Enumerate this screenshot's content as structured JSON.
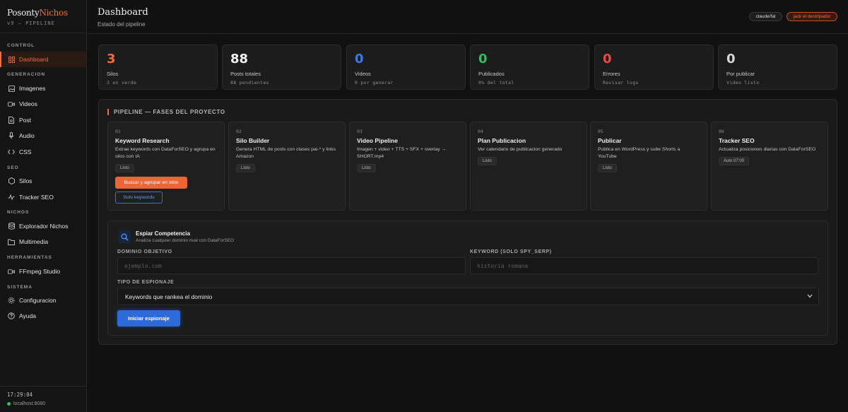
{
  "brand": {
    "title_a": "Posonty",
    "title_b": "Nichos",
    "subtitle": "v9 — PIPELINE"
  },
  "sidebar": {
    "sections": [
      {
        "label": "CONTROL",
        "items": [
          {
            "label": "Dashboard",
            "icon": "dashboard-icon",
            "active": true
          }
        ]
      },
      {
        "label": "GENERACION",
        "items": [
          {
            "label": "Imagenes",
            "icon": "image-icon"
          },
          {
            "label": "Videos",
            "icon": "video-icon"
          },
          {
            "label": "Post",
            "icon": "post-icon"
          },
          {
            "label": "Audio",
            "icon": "microphone-icon"
          },
          {
            "label": "CSS",
            "icon": "code-icon"
          }
        ]
      },
      {
        "label": "SEO",
        "items": [
          {
            "label": "Silos",
            "icon": "hexagon-icon"
          },
          {
            "label": "Tracker SEO",
            "icon": "trend-icon"
          }
        ]
      },
      {
        "label": "NICHOS",
        "items": [
          {
            "label": "Explorador Nichos",
            "icon": "database-icon"
          },
          {
            "label": "Multimedia",
            "icon": "folder-icon"
          }
        ]
      },
      {
        "label": "HERRAMIENTAS",
        "items": [
          {
            "label": "FFmpeg Studio",
            "icon": "video-icon"
          }
        ]
      },
      {
        "label": "SISTEMA",
        "items": [
          {
            "label": "Configuracion",
            "icon": "gear-icon"
          },
          {
            "label": "Ayuda",
            "icon": "help-icon"
          }
        ]
      }
    ],
    "clock": "17:29:04",
    "host": "localhost:8080"
  },
  "header": {
    "title": "Dashboard",
    "subtitle": "Estado del pipeline",
    "model_badge": "claude/fal",
    "user_badge": "jack el destripador"
  },
  "stats": [
    {
      "value": "3",
      "label": "Silos",
      "sub": "3 en verde",
      "color": "#f26b3a"
    },
    {
      "value": "88",
      "label": "Posts totales",
      "sub": "88 pendientes",
      "color": "#f2f2f2"
    },
    {
      "value": "0",
      "label": "Videos",
      "sub": "0 por generar",
      "color": "#3b7be6"
    },
    {
      "value": "0",
      "label": "Publicados",
      "sub": "0% del total",
      "color": "#2fbf5b"
    },
    {
      "value": "0",
      "label": "Errores",
      "sub": "Revisar logs",
      "color": "#ef4a3e"
    },
    {
      "value": "0",
      "label": "Por publicar",
      "sub": "Video listo",
      "color": "#d8d8d8"
    }
  ],
  "pipeline": {
    "title": "PIPELINE — FASES DEL PROYECTO",
    "phases": [
      {
        "num": "01",
        "title": "Keyword Research",
        "desc": "Extrae keywords con DataForSEO y agrupa en silos con IA",
        "status": "Listo"
      },
      {
        "num": "02",
        "title": "Silo Builder",
        "desc": "Genera HTML de posts con clases pai-* y links Amazon",
        "status": "Listo"
      },
      {
        "num": "03",
        "title": "Video Pipeline",
        "desc": "Imagen + video + TTS + SFX + overlay → SHORT.mp4",
        "status": "Listo"
      },
      {
        "num": "04",
        "title": "Plan Publicacion",
        "desc": "Ver calendario de publicacion generado",
        "status": "Listo"
      },
      {
        "num": "05",
        "title": "Publicar",
        "desc": "Publica en WordPress y sube Shorts a YouTube",
        "status": "Listo"
      },
      {
        "num": "06",
        "title": "Tracker SEO",
        "desc": "Actualiza posiciones diarias con DataForSEO",
        "status": "Auto 07:00"
      }
    ],
    "btn_group": "Buscar y agrupar en silos",
    "btn_keywords": "Solo keywords"
  },
  "spy": {
    "title": "Espiar Competencia",
    "subtitle": "Analiza cualquier dominio rival con DataForSEO",
    "domain_label": "DOMINIO OBJETIVO",
    "domain_placeholder": "ejemplo.com",
    "keyword_label": "KEYWORD (SOLO SPY_SERP)",
    "keyword_placeholder": "historia romana",
    "type_label": "TIPO DE ESPIONAJE",
    "type_selected": "Keywords que rankea el dominio",
    "submit": "Iniciar espionaje"
  }
}
